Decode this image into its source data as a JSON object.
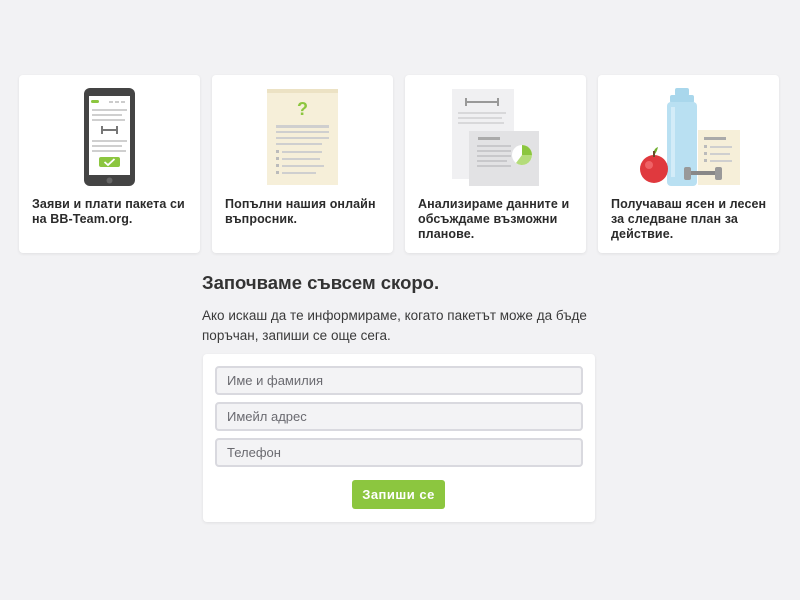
{
  "steps": [
    {
      "caption": "Заяви и плати пакета си на BB-Team.org."
    },
    {
      "caption": "Попълни нашия онлайн въпросник."
    },
    {
      "caption": "Анализираме данните и обсъждаме възможни планове."
    },
    {
      "caption": "Получаваш ясен и лесен за следване план за действие."
    }
  ],
  "signup": {
    "heading": "Започваме съвсем скоро.",
    "intro": "Ако искаш да те информираме, когато пакетът може да бъде поръчан, запиши се още сега.",
    "name_placeholder": "Име и фамилия",
    "email_placeholder": "Имейл адрес",
    "phone_placeholder": "Телефон",
    "submit_label": "Запиши се"
  },
  "colors": {
    "accent_green": "#8cc63f",
    "background": "#f2f2f4"
  }
}
